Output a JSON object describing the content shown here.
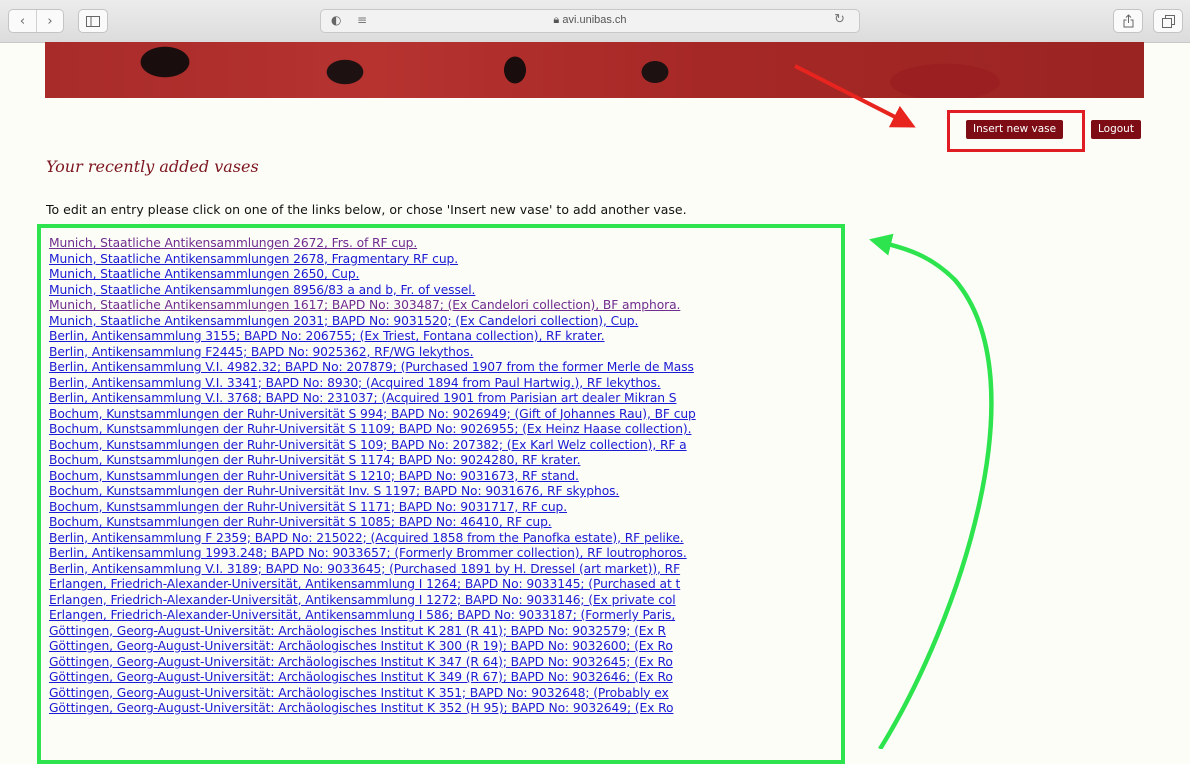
{
  "browser": {
    "url": "avi.unibas.ch",
    "icons": [
      "chevron-left-icon",
      "chevron-right-icon",
      "sidebar-icon",
      "privacy-shield-icon",
      "reader-icon",
      "lock-icon",
      "reload-icon",
      "share-icon",
      "tabs-icon"
    ]
  },
  "header": {
    "insert_label": "Insert new vase",
    "logout_label": "Logout"
  },
  "main": {
    "heading": "Your recently added vases",
    "intro": "To edit an entry please click on one of the links below, or chose 'Insert new vase' to add another vase.",
    "links": [
      {
        "text": "Munich, Staatliche Antikensammlungen 2672, Frs. of RF cup.",
        "visited": true
      },
      {
        "text": "Munich, Staatliche Antikensammlungen 2678, Fragmentary RF cup.",
        "visited": false
      },
      {
        "text": "Munich, Staatliche Antikensammlungen 2650, Cup.",
        "visited": false
      },
      {
        "text": "Munich, Staatliche Antikensammlungen 8956/83 a and b, Fr. of vessel.",
        "visited": false
      },
      {
        "text": "Munich, Staatliche Antikensammlungen 1617; BAPD No: 303487; (Ex Candelori collection), BF amphora.",
        "visited": true
      },
      {
        "text": "Munich, Staatliche Antikensammlungen 2031; BAPD No: 9031520; (Ex Candelori collection), Cup.",
        "visited": false
      },
      {
        "text": "Berlin, Antikensammlung 3155; BAPD No: 206755; (Ex Triest, Fontana collection), RF krater.",
        "visited": false
      },
      {
        "text": "Berlin, Antikensammlung F2445; BAPD No: 9025362, RF/WG lekythos.",
        "visited": false
      },
      {
        "text": "Berlin, Antikensammlung V.I. 4982.32; BAPD No: 207879; (Purchased 1907 from the former Merle de Mass",
        "visited": false
      },
      {
        "text": "Berlin, Antikensammlung V.I. 3341; BAPD No: 8930; (Acquired 1894 from Paul Hartwig.), RF lekythos.",
        "visited": false
      },
      {
        "text": "Berlin, Antikensammlung V.I. 3768; BAPD No: 231037; (Acquired 1901 from Parisian art dealer Mikran S",
        "visited": false
      },
      {
        "text": "Bochum, Kunstsammlungen der Ruhr-Universität S 994; BAPD No: 9026949; (Gift of Johannes Rau), BF cup",
        "visited": false
      },
      {
        "text": "Bochum, Kunstsammlungen der Ruhr-Universität S 1109; BAPD No: 9026955; (Ex Heinz Haase collection).",
        "visited": false
      },
      {
        "text": "Bochum, Kunstsammlungen der Ruhr-Universität S 109; BAPD No: 207382; (Ex Karl Welz collection), RF a",
        "visited": false
      },
      {
        "text": "Bochum, Kunstsammlungen der Ruhr-Universität S 1174; BAPD No: 9024280, RF krater.",
        "visited": false
      },
      {
        "text": "Bochum, Kunstsammlungen der Ruhr-Universität S 1210; BAPD No: 9031673, RF stand.",
        "visited": false
      },
      {
        "text": "Bochum, Kunstsammlungen der Ruhr-Universität Inv. S 1197; BAPD No: 9031676, RF skyphos.",
        "visited": false
      },
      {
        "text": "Bochum, Kunstsammlungen der Ruhr-Universität S 1171; BAPD No: 9031717, RF cup.",
        "visited": false
      },
      {
        "text": "Bochum, Kunstsammlungen der Ruhr-Universität S 1085; BAPD No: 46410, RF cup.",
        "visited": false
      },
      {
        "text": "Berlin, Antikensammlung F 2359; BAPD No: 215022; (Acquired 1858 from the Panofka estate), RF pelike.",
        "visited": false
      },
      {
        "text": "Berlin, Antikensammlung 1993.248; BAPD No: 9033657; (Formerly Brommer collection), RF loutrophoros.",
        "visited": false
      },
      {
        "text": "Berlin, Antikensammlung V.I. 3189; BAPD No: 9033645; (Purchased 1891 by H. Dressel (art market)), RF",
        "visited": false
      },
      {
        "text": "Erlangen, Friedrich-Alexander-Universität, Antikensammlung I 1264; BAPD No: 9033145; (Purchased at t",
        "visited": false
      },
      {
        "text": "Erlangen, Friedrich-Alexander-Universität, Antikensammlung I 1272; BAPD No: 9033146; (Ex private col",
        "visited": false
      },
      {
        "text": "Erlangen, Friedrich-Alexander-Universität, Antikensammlung I 586; BAPD No: 9033187; (Formerly Paris,",
        "visited": false
      },
      {
        "text": "Göttingen, Georg-August-Universität: Archäologisches Institut K 281 (R 41); BAPD No: 9032579; (Ex R",
        "visited": false
      },
      {
        "text": "Göttingen, Georg-August-Universität: Archäologisches Institut K 300 (R 19); BAPD No: 9032600; (Ex Ro",
        "visited": false
      },
      {
        "text": "Göttingen, Georg-August-Universität: Archäologisches Institut K 347 (R 64); BAPD No: 9032645; (Ex Ro",
        "visited": false
      },
      {
        "text": "Göttingen, Georg-August-Universität: Archäologisches Institut K 349 (R 67); BAPD No: 9032646; (Ex Ro",
        "visited": false
      },
      {
        "text": "Göttingen, Georg-August-Universität: Archäologisches Institut K 351; BAPD No: 9032648; (Probably ex",
        "visited": false
      },
      {
        "text": "Göttingen, Georg-August-Universität: Archäologisches Institut K 352 (H 95); BAPD No: 9032649; (Ex Ro",
        "visited": false
      }
    ]
  },
  "colors": {
    "accent": "#7d0c14",
    "link": "#1b1bd4",
    "link_visited": "#6f2d8f",
    "highlight_red": "#e11d24",
    "highlight_green": "#2ee44e"
  }
}
